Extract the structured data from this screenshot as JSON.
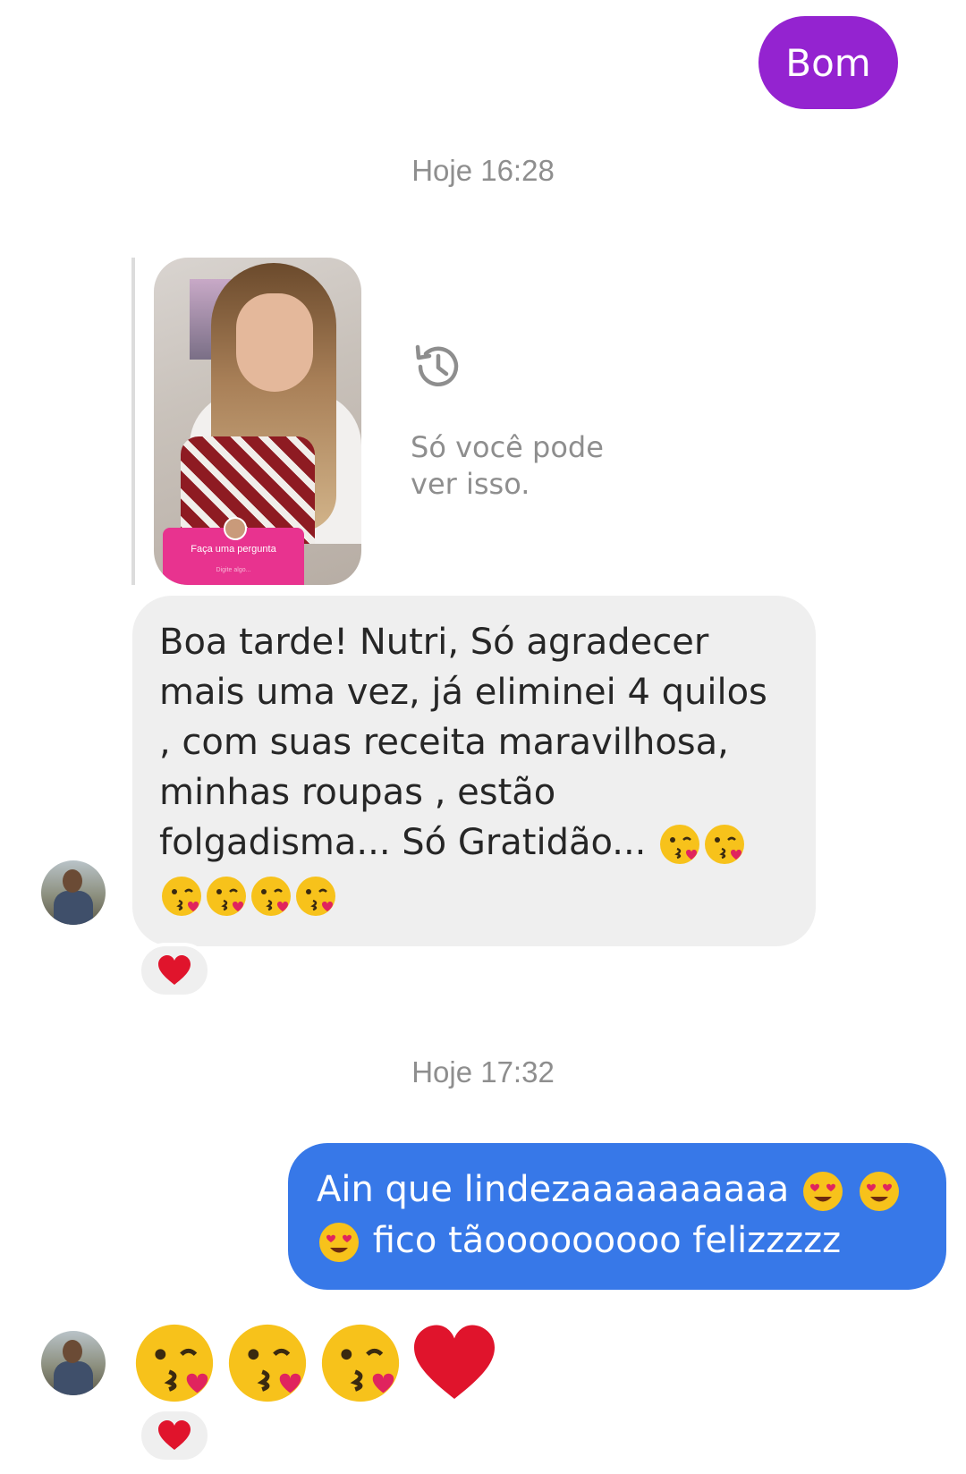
{
  "messages": {
    "sent_first": "Bom",
    "timestamp_1": "Hoje 16:28",
    "story_reply": {
      "note": "Só você pode ver isso.",
      "question_card": "Faça uma pergunta",
      "question_hint": "Digite algo..."
    },
    "received_text": "Boa tarde! Nutri, Só agradecer mais uma vez, já eliminei 4 quilos , com suas receita maravilhosa, minhas roupas , estão folgadisma... Só Gratidão...",
    "received_emojis": [
      "kissing-face",
      "kissing-face",
      "kissing-face",
      "kissing-face",
      "kissing-face",
      "kissing-face"
    ],
    "received_reaction": "red-heart",
    "timestamp_2": "Hoje 17:32",
    "sent_text_line1": "Ain que lindezaaaaaaaaaa",
    "sent_text_line2": "fico tãooooooooo felizzzzz",
    "sent_emojis": [
      "heart-eyes-face",
      "heart-eyes-face",
      "heart-eyes-face"
    ],
    "received_big_emojis": [
      "kissing-face",
      "kissing-face",
      "kissing-face",
      "red-heart"
    ],
    "received_big_reaction": "red-heart"
  },
  "colors": {
    "sent_purple": "#9423d0",
    "sent_blue": "#3778e8",
    "received_bg": "#efefef",
    "meta_text": "#8e8e8e"
  }
}
